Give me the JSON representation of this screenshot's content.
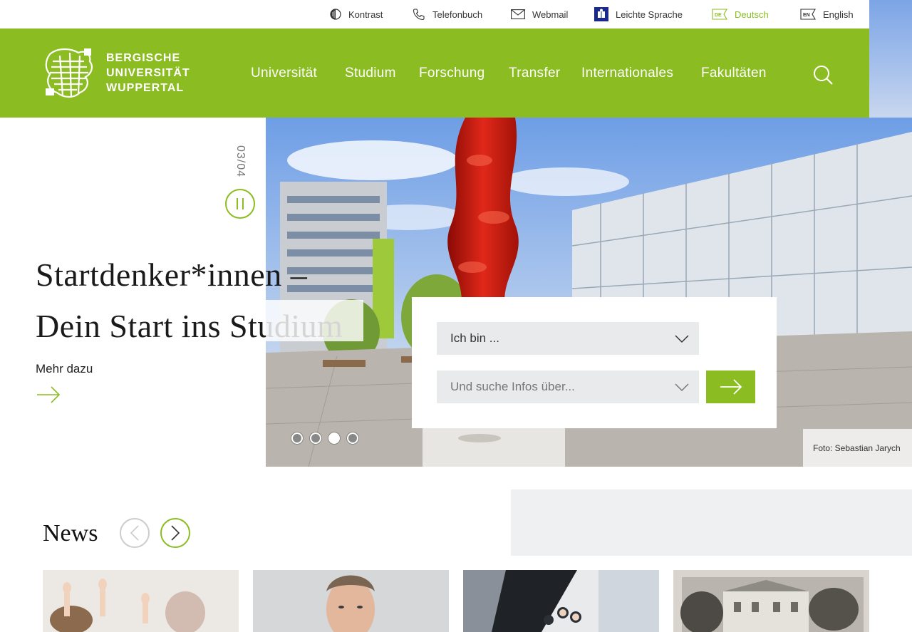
{
  "utility": {
    "kontrast": "Kontrast",
    "telefonbuch": "Telefonbuch",
    "webmail": "Webmail",
    "leichte_sprache": "Leichte Sprache",
    "deutsch": "Deutsch",
    "deutsch_badge": "DE",
    "english": "English",
    "english_badge": "EN"
  },
  "brand": {
    "line1": "BERGISCHE",
    "line2": "UNIVERSITÄT",
    "line3": "WUPPERTAL",
    "accent": "#8bbd22"
  },
  "nav": [
    "Universität",
    "Studium",
    "Forschung",
    "Transfer",
    "Internationales",
    "Fakultäten"
  ],
  "hero": {
    "counter": "03/04",
    "title_line1": "Startdenker*innen –",
    "title_line2": "Dein Start ins Studium",
    "more": "Mehr dazu",
    "credit": "Foto: Sebastian Jarych",
    "active_slide": 3,
    "slide_count": 4
  },
  "finder": {
    "select1": "Ich bin ...",
    "select2": "Und suche Infos über..."
  },
  "news": {
    "title": "News"
  }
}
